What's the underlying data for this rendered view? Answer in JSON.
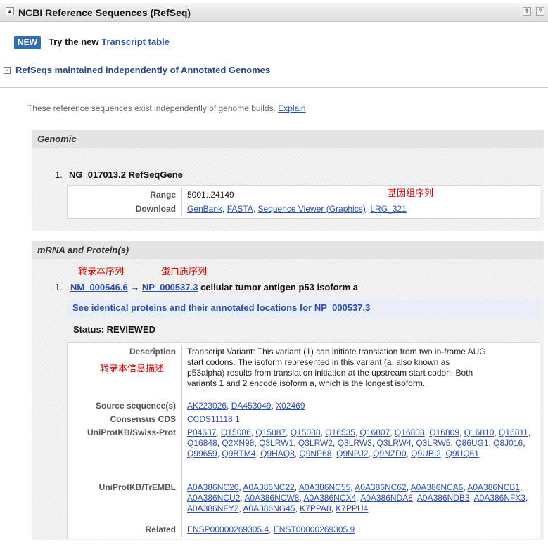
{
  "header": {
    "collapse_icon": "▲",
    "title": "NCBI Reference Sequences (RefSeq)",
    "btn_expand": "⇑",
    "btn_help": "?"
  },
  "new_banner": {
    "badge": "NEW",
    "text": "Try the new",
    "link": "Transcript table"
  },
  "section": {
    "toggle": "−",
    "title": "RefSeqs maintained independently of Annotated Genomes",
    "intro": "These reference sequences exist independently of genome builds.",
    "intro_link": "Explain"
  },
  "genomic": {
    "header": "Genomic",
    "item_num": "1.",
    "item_title": "NG_017013.2 RefSeqGene",
    "annotation": "基因组序列",
    "range_label": "Range",
    "range_value": "5001..24149",
    "download_label": "Download",
    "download_links": [
      "GenBank",
      "FASTA",
      "Sequence Viewer (Graphics)",
      "LRG_321"
    ]
  },
  "mrna": {
    "header": "mRNA and Protein(s)",
    "annotation_transcript": "转录本序列",
    "annotation_protein": "蛋白质序列",
    "item_num": "1.",
    "transcript_link": "NM_000546.6",
    "arrow": "→",
    "protein_link": "NP_000537.3",
    "item_desc": "cellular tumor antigen p53 isoform a",
    "identical_link": "See identical proteins and their annotated locations for NP_000537.3",
    "status": "Status: REVIEWED",
    "description_label": "Description",
    "annotation_description": "转录本信息描述",
    "description_lines": [
      "Transcript Variant: This variant (1) can initiate translation from two in-frame AUG",
      "start codons. The isoform represented in this variant (a, also known as",
      "p53alpha) results from translation initiation at the upstream start codon. Both",
      "variants 1 and 2 encode isoform a, which is the longest isoform."
    ],
    "source_label": "Source sequence(s)",
    "source_links": [
      "AK223026",
      "DA453049",
      "X02469"
    ],
    "ccds_label": "Consensus CDS",
    "ccds_links": [
      "CCDS11118.1"
    ],
    "swissprot_label": "UniProtKB/Swiss-Prot",
    "swissprot_links": [
      "P04637",
      "Q15086",
      "Q15087",
      "Q15088",
      "Q16535",
      "Q16807",
      "Q16808",
      "Q16809",
      "Q16810",
      "Q16811",
      "Q16848",
      "Q2XN98",
      "Q3LRW1",
      "Q3LRW2",
      "Q3LRW3",
      "Q3LRW4",
      "Q3LRW5",
      "Q86UG1",
      "Q8J016",
      "Q99659",
      "Q9BTM4",
      "Q9HAQ8",
      "Q9NP68",
      "Q9NPJ2",
      "Q9NZD0",
      "Q9UBI2",
      "Q9UQ61"
    ],
    "trembl_label": "UniProtKB/TrEMBL",
    "trembl_links": [
      "A0A386NC20",
      "A0A386NC22",
      "A0A386NC55",
      "A0A386NC62",
      "A0A386NCA6",
      "A0A386NCB1",
      "A0A386NCU2",
      "A0A386NCW8",
      "A0A386NCX4",
      "A0A386NDA8",
      "A0A386NDB3",
      "A0A386NFX3",
      "A0A386NFY2",
      "A0A386NG45",
      "K7PPA8",
      "K7PPU4"
    ],
    "related_label": "Related",
    "related_links": [
      "ENSP00000269305.4",
      "ENST00000269305.9"
    ]
  }
}
